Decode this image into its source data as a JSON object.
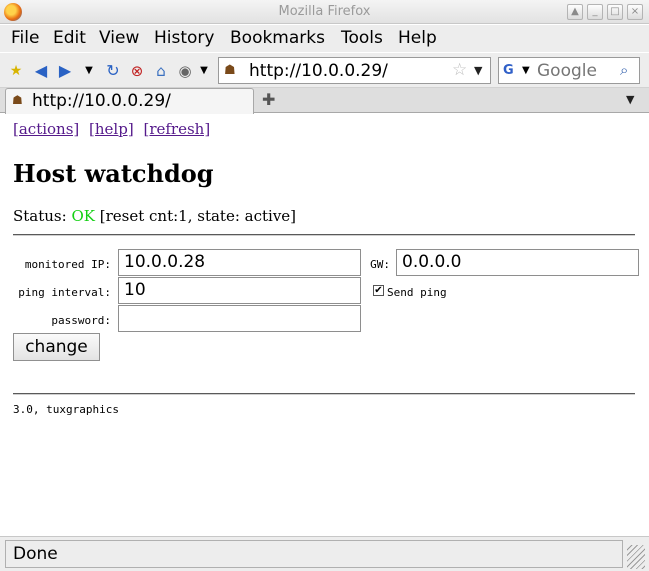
{
  "window": {
    "title": "Mozilla Firefox"
  },
  "menu": {
    "items": [
      {
        "label": "File"
      },
      {
        "label": "Edit"
      },
      {
        "label": "View"
      },
      {
        "label": "History"
      },
      {
        "label": "Bookmarks"
      },
      {
        "label": "Tools"
      },
      {
        "label": "Help"
      }
    ]
  },
  "toolbar": {
    "icons": [
      "new-icon",
      "back-icon",
      "forward-icon",
      "history-dropdown-icon",
      "reload-icon",
      "stop-icon",
      "home-icon",
      "globe-icon"
    ],
    "url": "http://10.0.0.29/",
    "search_placeholder": "Google",
    "search_engine_icon": "google-icon"
  },
  "tab": {
    "title": "http://10.0.0.29/"
  },
  "page": {
    "links": [
      "[actions]",
      "[help]",
      "[refresh]"
    ],
    "title": "Host watchdog",
    "status_prefix": "Status:",
    "status_value": "OK",
    "status_detail": "[reset cnt:1, state: active]",
    "form": {
      "monitored_ip_label": "monitored IP:",
      "monitored_ip_value": "10.0.0.28",
      "gw_label": "GW:",
      "gw_value": "0.0.0.0",
      "ping_interval_label": "ping interval:",
      "ping_interval_value": "10",
      "send_ping_label": "Send ping",
      "send_ping_checked": true,
      "password_label": "password:",
      "password_value": "",
      "submit_label": "change"
    },
    "footer": "3.0, tuxgraphics"
  },
  "statusbar": {
    "text": "Done"
  },
  "colors": {
    "status_ok": "#13d013",
    "visited_link": "#551a8b"
  }
}
